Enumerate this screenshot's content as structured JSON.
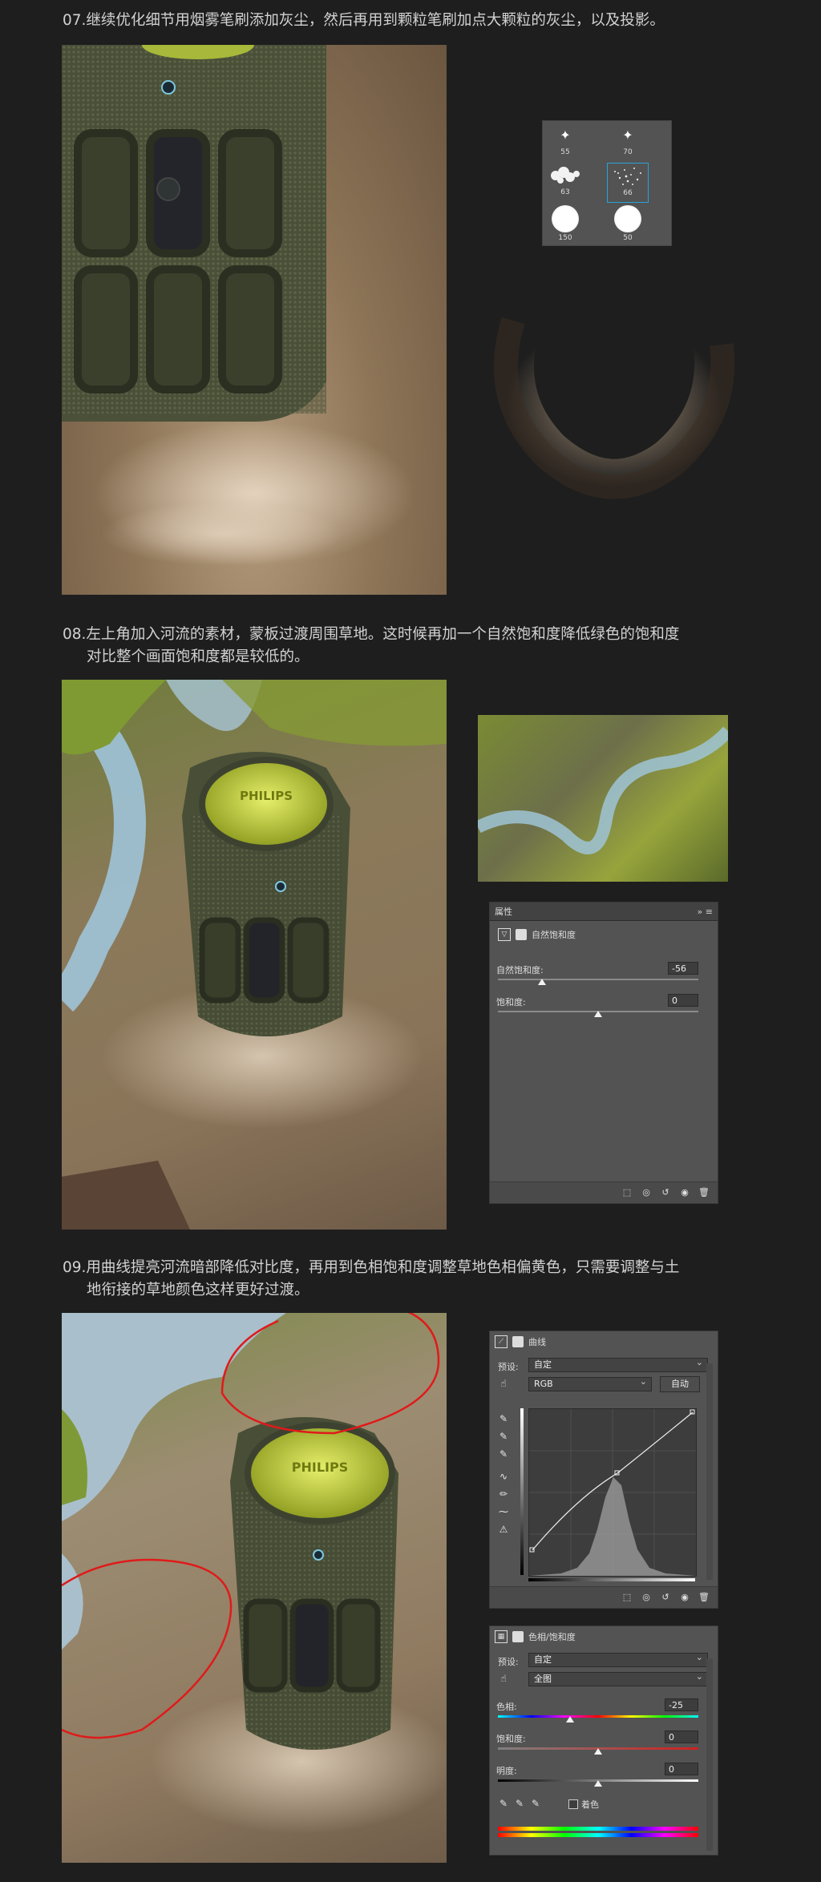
{
  "steps": {
    "s07": "07.继续优化细节用烟雾笔刷添加灰尘，然后再用到颗粒笔刷加点大颗粒的灰尘，以及投影。",
    "s08_line1": "08.左上角加入河流的素材，蒙板过渡周围草地。这时候再加一个自然饱和度降低绿色的饱和度",
    "s08_line2": "对比整个画面饱和度都是较低的。",
    "s09_line1": "09.用曲线提亮河流暗部降低对比度，再用到色相饱和度调整草地色相偏黄色，只需要调整与土",
    "s09_line2": "地衔接的草地颜色这样更好过渡。"
  },
  "product": {
    "brand": "PHILIPS"
  },
  "brushes": [
    {
      "size": "55"
    },
    {
      "size": "70"
    },
    {
      "size": "63"
    },
    {
      "size": "66"
    },
    {
      "size": "150"
    },
    {
      "size": "50"
    }
  ],
  "vibrance_panel": {
    "tab_label": "属性",
    "title": "自然饱和度",
    "vibrance_label": "自然饱和度:",
    "vibrance_value": "-56",
    "saturation_label": "饱和度:",
    "saturation_value": "0"
  },
  "curves_panel": {
    "title": "曲线",
    "preset_label": "预设:",
    "preset_value": "自定",
    "channel_value": "RGB",
    "auto_label": "自动"
  },
  "hue_panel": {
    "title": "色相/饱和度",
    "preset_label": "预设:",
    "preset_value": "自定",
    "range_value": "全图",
    "hue_label": "色相:",
    "hue_value": "-25",
    "sat_label": "饱和度:",
    "sat_value": "0",
    "light_label": "明度:",
    "light_value": "0",
    "colorize_label": "着色"
  },
  "colors": {
    "bg": "#1e1e1e",
    "panel": "#535353",
    "accent_highlight": "#2aa3d8",
    "annotation": "#e01a1a"
  }
}
